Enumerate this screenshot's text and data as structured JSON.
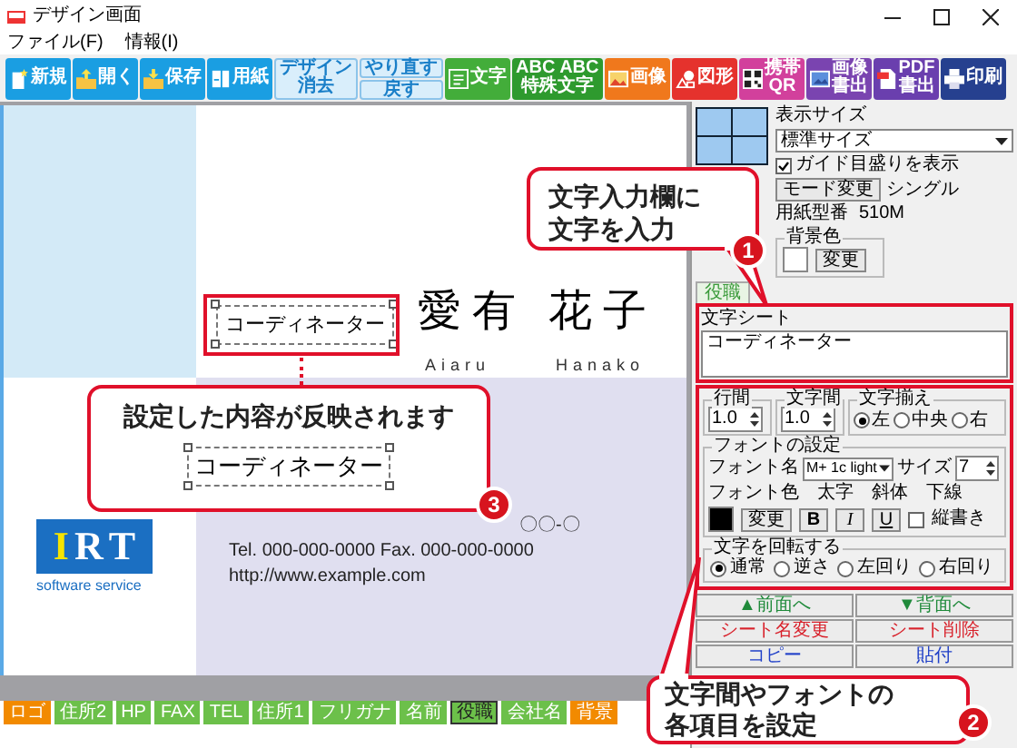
{
  "window": {
    "title": "デザイン画面"
  },
  "menu": [
    {
      "label": "ファイル(F)"
    },
    {
      "label": "情報(I)"
    }
  ],
  "toolbar": [
    {
      "kind": "icon",
      "label": "新規",
      "color": "#1a9ee2"
    },
    {
      "kind": "icon",
      "label": "開く",
      "color": "#1a9ee2"
    },
    {
      "kind": "icon",
      "label": "保存",
      "color": "#1a9ee2"
    },
    {
      "kind": "icon",
      "label": "用紙",
      "color": "#1a9ee2"
    },
    {
      "kind": "two-line",
      "lines": [
        "デザイン",
        "消去"
      ],
      "color": "#d9eefb"
    },
    {
      "kind": "stack",
      "buttons": [
        "やり直す",
        "戻す"
      ],
      "color": "#d9eefb"
    },
    {
      "kind": "icon",
      "label": "文字",
      "color": "#43ad3a"
    },
    {
      "kind": "two-line",
      "lines": [
        "ABC ABC",
        "特殊文字"
      ],
      "color": "#2e9a2e"
    },
    {
      "kind": "icon",
      "label": "画像",
      "color": "#f0781c"
    },
    {
      "kind": "icon",
      "label": "図形",
      "color": "#e5322d"
    },
    {
      "kind": "icon-two-line",
      "lines": [
        "携帯",
        "QR"
      ],
      "color": "#d2409c"
    },
    {
      "kind": "icon-two-line",
      "lines": [
        "画像",
        "書出"
      ],
      "color": "#7a44b0"
    },
    {
      "kind": "icon-two-line",
      "lines": [
        "PDF",
        "書出"
      ],
      "color": "#6a3fae"
    },
    {
      "kind": "icon",
      "label": "印刷",
      "color": "#26408f"
    }
  ],
  "card": {
    "title": "コーディネーター",
    "name": [
      "愛有",
      "花子"
    ],
    "reading": [
      "Aiaru",
      "Hanako"
    ],
    "logo": {
      "letters": [
        {
          "text": "I",
          "color": "#f5e400"
        },
        {
          "text": "R",
          "color": "#ffffff"
        },
        {
          "text": "T",
          "color": "#ffffff"
        }
      ],
      "tagline": "software service"
    },
    "address": "〇〇-〇",
    "tel": "Tel. 000-000-0000 Fax. 000-000-0000",
    "url": "http://www.example.com"
  },
  "display": {
    "label": "表示サイズ",
    "size": "標準サイズ",
    "guide": {
      "label": "ガイド目盛りを表示",
      "checked": true
    },
    "mode_button": "モード変更",
    "mode": "シングル",
    "paper_label": "用紙型番",
    "paper": "510M",
    "background": {
      "label": "背景色",
      "button": "変更"
    }
  },
  "sheet_tab": "役職",
  "text_sheet": {
    "label": "文字シート",
    "value": "コーディネーター"
  },
  "spacing": [
    {
      "label": "行間",
      "value": "1.0"
    },
    {
      "label": "文字間",
      "value": "1.0"
    }
  ],
  "align": {
    "label": "文字揃え",
    "options": [
      {
        "label": "左",
        "selected": true
      },
      {
        "label": "中央",
        "selected": false
      },
      {
        "label": "右",
        "selected": false
      }
    ]
  },
  "font": {
    "label": "フォントの設定",
    "name_label": "フォント名",
    "name": "M+ 1c light",
    "size_label": "サイズ",
    "size": "7",
    "color_label": "フォント色",
    "color": "#000000",
    "color_button": "変更",
    "styles": [
      {
        "label": "太字",
        "button": "B"
      },
      {
        "label": "斜体",
        "button": "I"
      },
      {
        "label": "下線",
        "button": "U"
      }
    ],
    "vertical": {
      "label": "縦書き",
      "checked": false
    }
  },
  "rotation": {
    "label": "文字を回転する",
    "options": [
      {
        "label": "通常",
        "selected": true
      },
      {
        "label": "逆さ",
        "selected": false
      },
      {
        "label": "左回り",
        "selected": false
      },
      {
        "label": "右回り",
        "selected": false
      }
    ]
  },
  "sheet_buttons": [
    {
      "label": "▲前面へ",
      "color": "#1f8a3a"
    },
    {
      "label": "▼背面へ",
      "color": "#1f8a3a"
    },
    {
      "label": "シート名変更",
      "color": "#d8202a"
    },
    {
      "label": "シート削除",
      "color": "#d8202a"
    },
    {
      "label": "コピー",
      "color": "#2040c8"
    },
    {
      "label": "貼付",
      "color": "#2040c8"
    }
  ],
  "sheets": [
    {
      "label": "ロゴ",
      "color": "#f28a00",
      "selected": false
    },
    {
      "label": "住所2",
      "color": "#6cc04a",
      "selected": false
    },
    {
      "label": "HP",
      "color": "#6cc04a",
      "selected": false
    },
    {
      "label": "FAX",
      "color": "#6cc04a",
      "selected": false
    },
    {
      "label": "TEL",
      "color": "#6cc04a",
      "selected": false
    },
    {
      "label": "住所1",
      "color": "#6cc04a",
      "selected": false
    },
    {
      "label": "フリガナ",
      "color": "#6cc04a",
      "selected": false
    },
    {
      "label": "名前",
      "color": "#6cc04a",
      "selected": false
    },
    {
      "label": "役職",
      "color": "#6cc04a",
      "selected": true
    },
    {
      "label": "会社名",
      "color": "#6cc04a",
      "selected": false
    },
    {
      "label": "背景",
      "color": "#f28a00",
      "selected": false
    }
  ],
  "callouts": [
    {
      "number": "1",
      "lines": [
        "文字入力欄に",
        "文字を入力"
      ]
    },
    {
      "number": "2",
      "lines": [
        "文字間やフォントの",
        "各項目を設定"
      ]
    },
    {
      "number": "3",
      "lines": [
        "設定した内容が反映されます"
      ],
      "preview": "コーディネーター"
    }
  ]
}
